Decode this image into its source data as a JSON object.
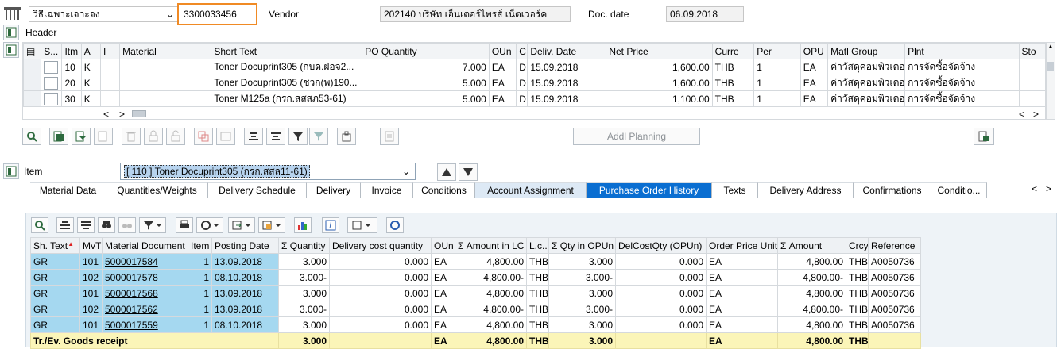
{
  "header_bar": {
    "doc_type": "วิธีเฉพาะเจาะจง",
    "doc_number": "3300033456",
    "vendor_label": "Vendor",
    "vendor_value": "202140 บริษัท เอ็นเตอร์ไพรส์ เน็ตเวอร์ค",
    "docdate_label": "Doc. date",
    "docdate_value": "06.09.2018",
    "header_label": "Header"
  },
  "items_table": {
    "columns": [
      "S...",
      "Itm",
      "A",
      "I",
      "Material",
      "Short Text",
      "PO Quantity",
      "OUn",
      "C",
      "Deliv. Date",
      "Net Price",
      "Curre",
      "Per",
      "OPU",
      "Matl Group",
      "Plnt",
      "Sto"
    ],
    "rows": [
      [
        "10",
        "K",
        "",
        "",
        "Toner Docuprint305 (กบด.ฝ่อจ2...",
        "7.000",
        "EA",
        "D",
        "15.09.2018",
        "1,600.00",
        "THB",
        "1",
        "EA",
        "ค่าวัสดุคอมพิวเตอร์",
        "การจัดซื้อจัดจ้าง"
      ],
      [
        "20",
        "K",
        "",
        "",
        "Toner Docuprint305 (ชวก(พ)190...",
        "5.000",
        "EA",
        "D",
        "15.09.2018",
        "1,600.00",
        "THB",
        "1",
        "EA",
        "ค่าวัสดุคอมพิวเตอร์",
        "การจัดซื้อจัดจ้าง"
      ],
      [
        "30",
        "K",
        "",
        "",
        "Toner M125a (กรก.สสสภ53-61)",
        "5.000",
        "EA",
        "D",
        "15.09.2018",
        "1,100.00",
        "THB",
        "1",
        "EA",
        "ค่าวัสดุคอมพิวเตอร์",
        "การจัดซื้อจัดจ้าง"
      ]
    ],
    "addl_planning": "Addl Planning"
  },
  "item_section": {
    "label": "Item",
    "selected": "[ 110 ] Toner Docuprint305 (กรก.สสล11-61)"
  },
  "tabs": [
    "Material Data",
    "Quantities/Weights",
    "Delivery Schedule",
    "Delivery",
    "Invoice",
    "Conditions",
    "Account Assignment",
    "Purchase Order History",
    "Texts",
    "Delivery Address",
    "Confirmations",
    "Conditio..."
  ],
  "active_tab": "Purchase Order History",
  "history": {
    "columns": [
      "Sh. Text",
      "MvT",
      "Material Document",
      "Item",
      "Posting Date",
      "Σ Quantity",
      "Delivery cost quantity",
      "OUn",
      "Σ Amount in LC",
      "L.c...",
      "Σ Qty in OPUn",
      "DelCostQty (OPUn)",
      "Order Price Unit",
      "Σ Amount",
      "Crcy",
      "Reference"
    ],
    "rows": [
      [
        "GR",
        "101",
        "5000017584",
        "1",
        "13.09.2018",
        "3.000",
        "0.000",
        "EA",
        "4,800.00",
        "THB",
        "3.000",
        "0.000",
        "EA",
        "4,800.00",
        "THB",
        "A0050736"
      ],
      [
        "GR",
        "102",
        "5000017578",
        "1",
        "08.10.2018",
        "3.000-",
        "0.000",
        "EA",
        "4,800.00-",
        "THB",
        "3.000-",
        "0.000",
        "EA",
        "4,800.00-",
        "THB",
        "A0050736"
      ],
      [
        "GR",
        "101",
        "5000017568",
        "1",
        "13.09.2018",
        "3.000",
        "0.000",
        "EA",
        "4,800.00",
        "THB",
        "3.000",
        "0.000",
        "EA",
        "4,800.00",
        "THB",
        "A0050736"
      ],
      [
        "GR",
        "102",
        "5000017562",
        "1",
        "13.09.2018",
        "3.000-",
        "0.000",
        "EA",
        "4,800.00-",
        "THB",
        "3.000-",
        "0.000",
        "EA",
        "4,800.00-",
        "THB",
        "A0050736"
      ],
      [
        "GR",
        "101",
        "5000017559",
        "1",
        "08.10.2018",
        "3.000",
        "0.000",
        "EA",
        "4,800.00",
        "THB",
        "3.000",
        "0.000",
        "EA",
        "4,800.00",
        "THB",
        "A0050736"
      ]
    ],
    "summary": {
      "label": "Tr./Ev. Goods receipt",
      "quantity": "3.000",
      "oun": "EA",
      "amount_lc": "4,800.00",
      "lc": "THB",
      "qty_opun": "3.000",
      "opu": "EA",
      "amount": "4,800.00",
      "crcy": "THB"
    }
  },
  "colors": {
    "accent": "#0a6ed1",
    "highlight_box": "#f08a24",
    "qty_cell": "#a5d8f0",
    "summary_row": "#fbf5b8"
  }
}
